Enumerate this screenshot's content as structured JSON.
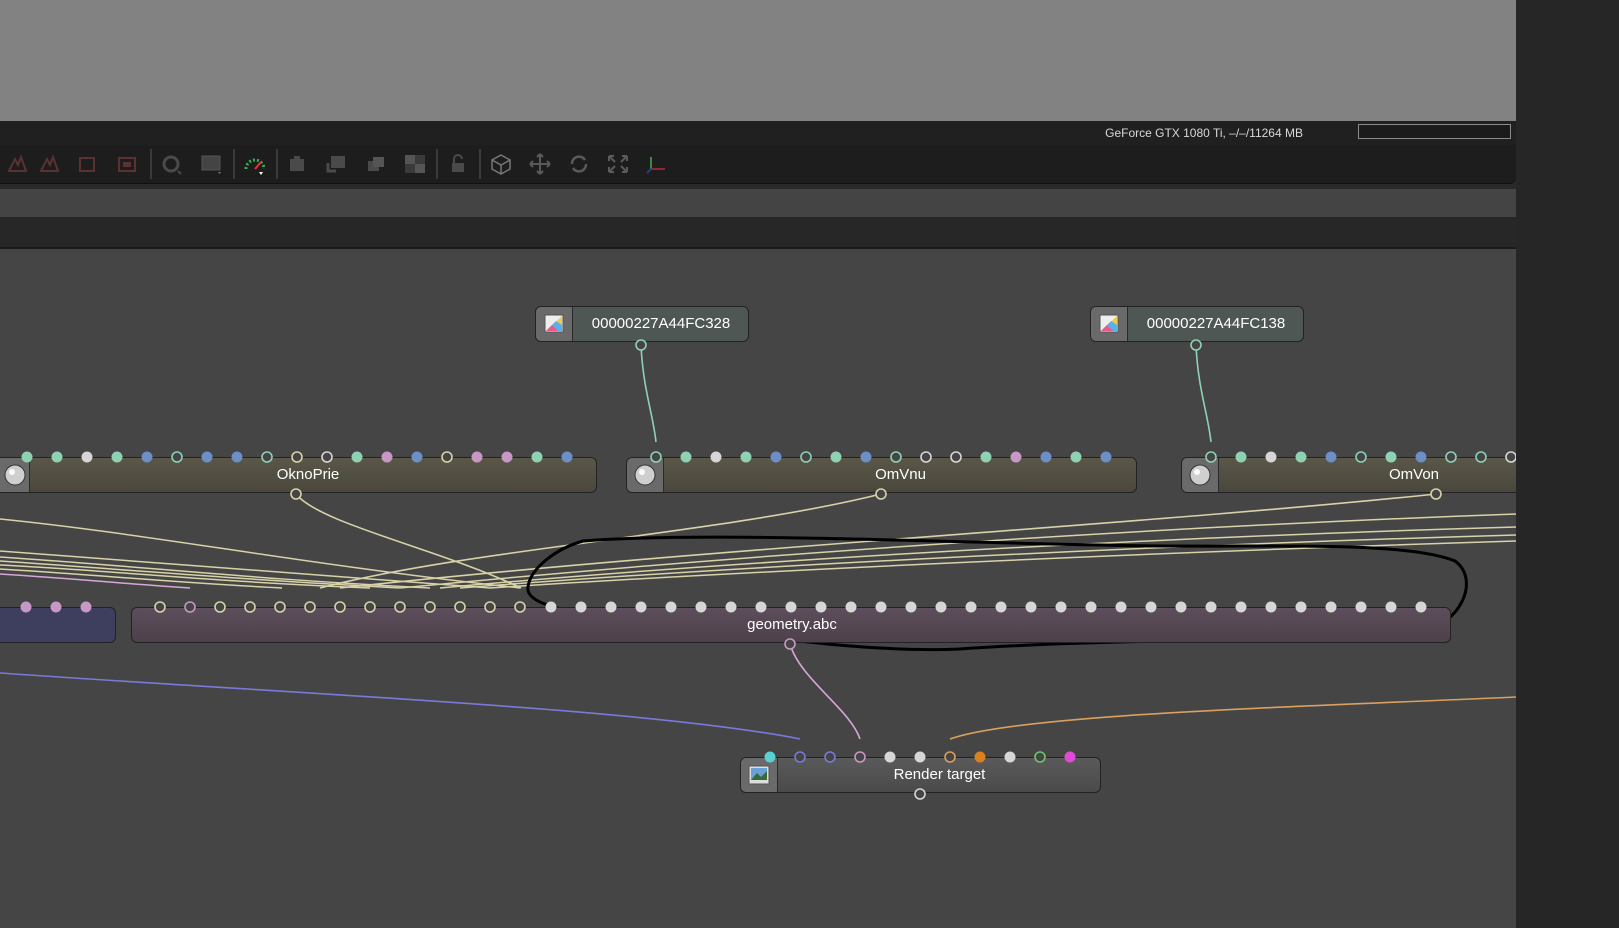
{
  "gpu_status": {
    "label": "GeForce GTX 1080 Ti, –/–/11264 MB"
  },
  "toolbar": {
    "icons": [
      "scene-icon",
      "scene-icon",
      "scene-icon",
      "scene-icon",
      "camera-icon",
      "region-icon",
      "performance-gauge-icon",
      "copy-icon",
      "paste-icon",
      "layers-icon",
      "checker-icon",
      "lock-icon",
      "box-icon",
      "move-icon",
      "rotate-icon",
      "scale-icon",
      "axis-icon"
    ]
  },
  "nodes": {
    "texture_1": {
      "title": "00000227A44FC328",
      "icon": "image-texture-icon"
    },
    "texture_2": {
      "title": "00000227A44FC138",
      "icon": "image-texture-icon"
    },
    "material_1": {
      "title": "OknoPrie",
      "icon": "material-sphere-icon"
    },
    "material_2": {
      "title": "OmVnu",
      "icon": "material-sphere-icon"
    },
    "material_3": {
      "title": "OmVon",
      "icon": "material-sphere-icon"
    },
    "geometry": {
      "title": "geometry.abc"
    },
    "render_target": {
      "title": "Render target",
      "icon": "render-target-icon"
    }
  },
  "colors": {
    "background": "#454545",
    "wire_material": "#d8d2a8",
    "wire_texture": "#8fd1b3",
    "wire_geometry": "#d9a6d6",
    "wire_blue": "#7b79d9",
    "wire_orange": "#d9a05f",
    "annotation": "#000000"
  }
}
